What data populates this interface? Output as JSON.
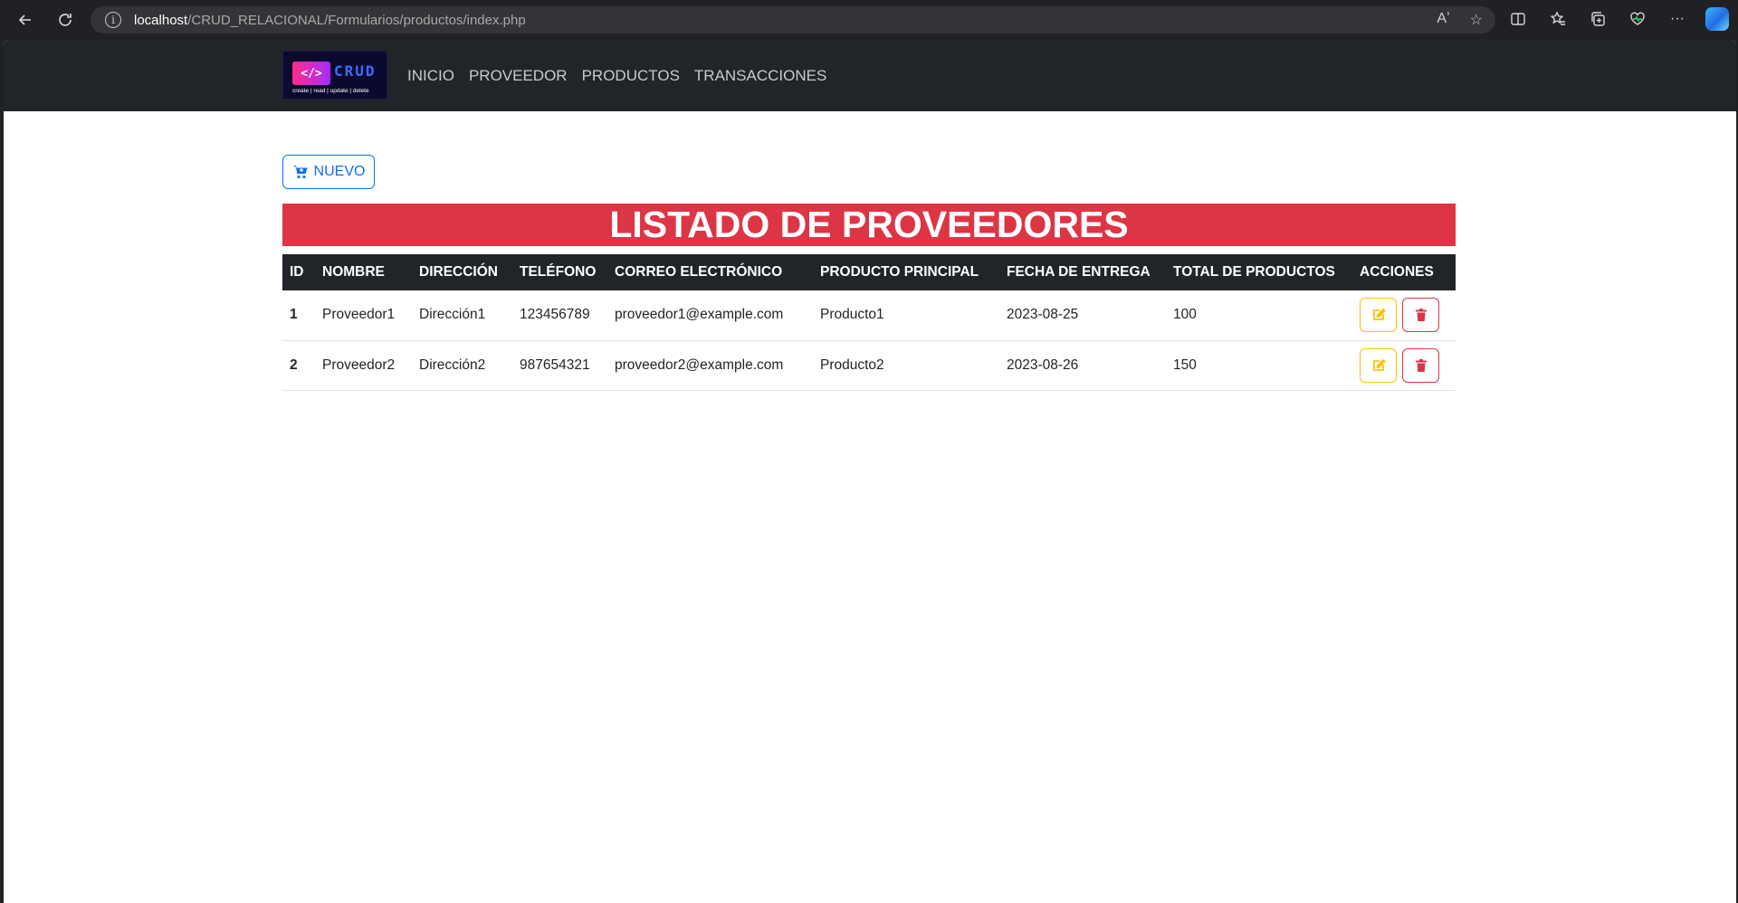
{
  "browser": {
    "url_host": "localhost",
    "url_path": "/CRUD_RELACIONAL/Formularios/productos/index.php",
    "read_aloud": "Aʼ"
  },
  "logo": {
    "code": "</>",
    "name": "CRUD",
    "tagline": "create | read | update | delete"
  },
  "nav": {
    "items": [
      "INICIO",
      "PROVEEDOR",
      "PRODUCTOS",
      "TRANSACCIONES"
    ]
  },
  "new_button": {
    "label": "NUEVO"
  },
  "title": "LISTADO DE PROVEEDORES",
  "table": {
    "columns": [
      "ID",
      "NOMBRE",
      "DIRECCIÓN",
      "TELÉFONO",
      "CORREO ELECTRÓNICO",
      "PRODUCTO PRINCIPAL",
      "FECHA DE ENTREGA",
      "TOTAL DE PRODUCTOS",
      "ACCIONES"
    ],
    "rows": [
      {
        "id": "1",
        "nombre": "Proveedor1",
        "direccion": "Dirección1",
        "telefono": "123456789",
        "correo": "proveedor1@example.com",
        "producto": "Producto1",
        "fecha": "2023-08-25",
        "total": "100"
      },
      {
        "id": "2",
        "nombre": "Proveedor2",
        "direccion": "Dirección2",
        "telefono": "987654321",
        "correo": "proveedor2@example.com",
        "producto": "Producto2",
        "fecha": "2023-08-26",
        "total": "150"
      }
    ]
  },
  "colors": {
    "primary": "#0d6efd",
    "danger": "#dc3545",
    "warning": "#ffc107",
    "dark": "#212529"
  }
}
